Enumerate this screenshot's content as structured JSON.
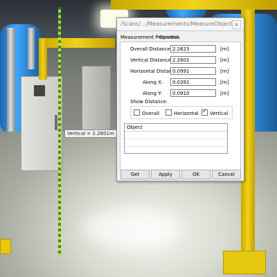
{
  "dialog": {
    "title": "/Scans/.../Measurements/MeasureObject",
    "tabs": [
      "Measurement Properties",
      "General"
    ],
    "fields": [
      {
        "label": "Overall Distance:",
        "value": "2.2623",
        "unit": "[m]"
      },
      {
        "label": "Vertical Distance:",
        "value": "2.2601",
        "unit": "[m]"
      },
      {
        "label": "Horizontal Distance:",
        "value": "0.0991",
        "unit": "[m]"
      },
      {
        "label": "Along X:",
        "value": "0.0391",
        "unit": "[m]"
      },
      {
        "label": "Along Y:",
        "value": "0.0910",
        "unit": "[m]"
      }
    ],
    "show_distance_label": "Show Distance:",
    "checkboxes": [
      {
        "label": "Overall",
        "checked": false
      },
      {
        "label": "Horizontal",
        "checked": false
      },
      {
        "label": "Vertical",
        "checked": true
      }
    ],
    "table_header": "Object",
    "buttons": [
      "Get",
      "Apply",
      "OK",
      "Cancel"
    ]
  },
  "scene": {
    "tooltip": "Vertical = 2.2601m",
    "colors": {
      "measure_line": "#1d8a3d",
      "measure_line_alt": "#d9e019",
      "frame": "#f0d21a",
      "pipes": "#3ea7ff"
    }
  }
}
